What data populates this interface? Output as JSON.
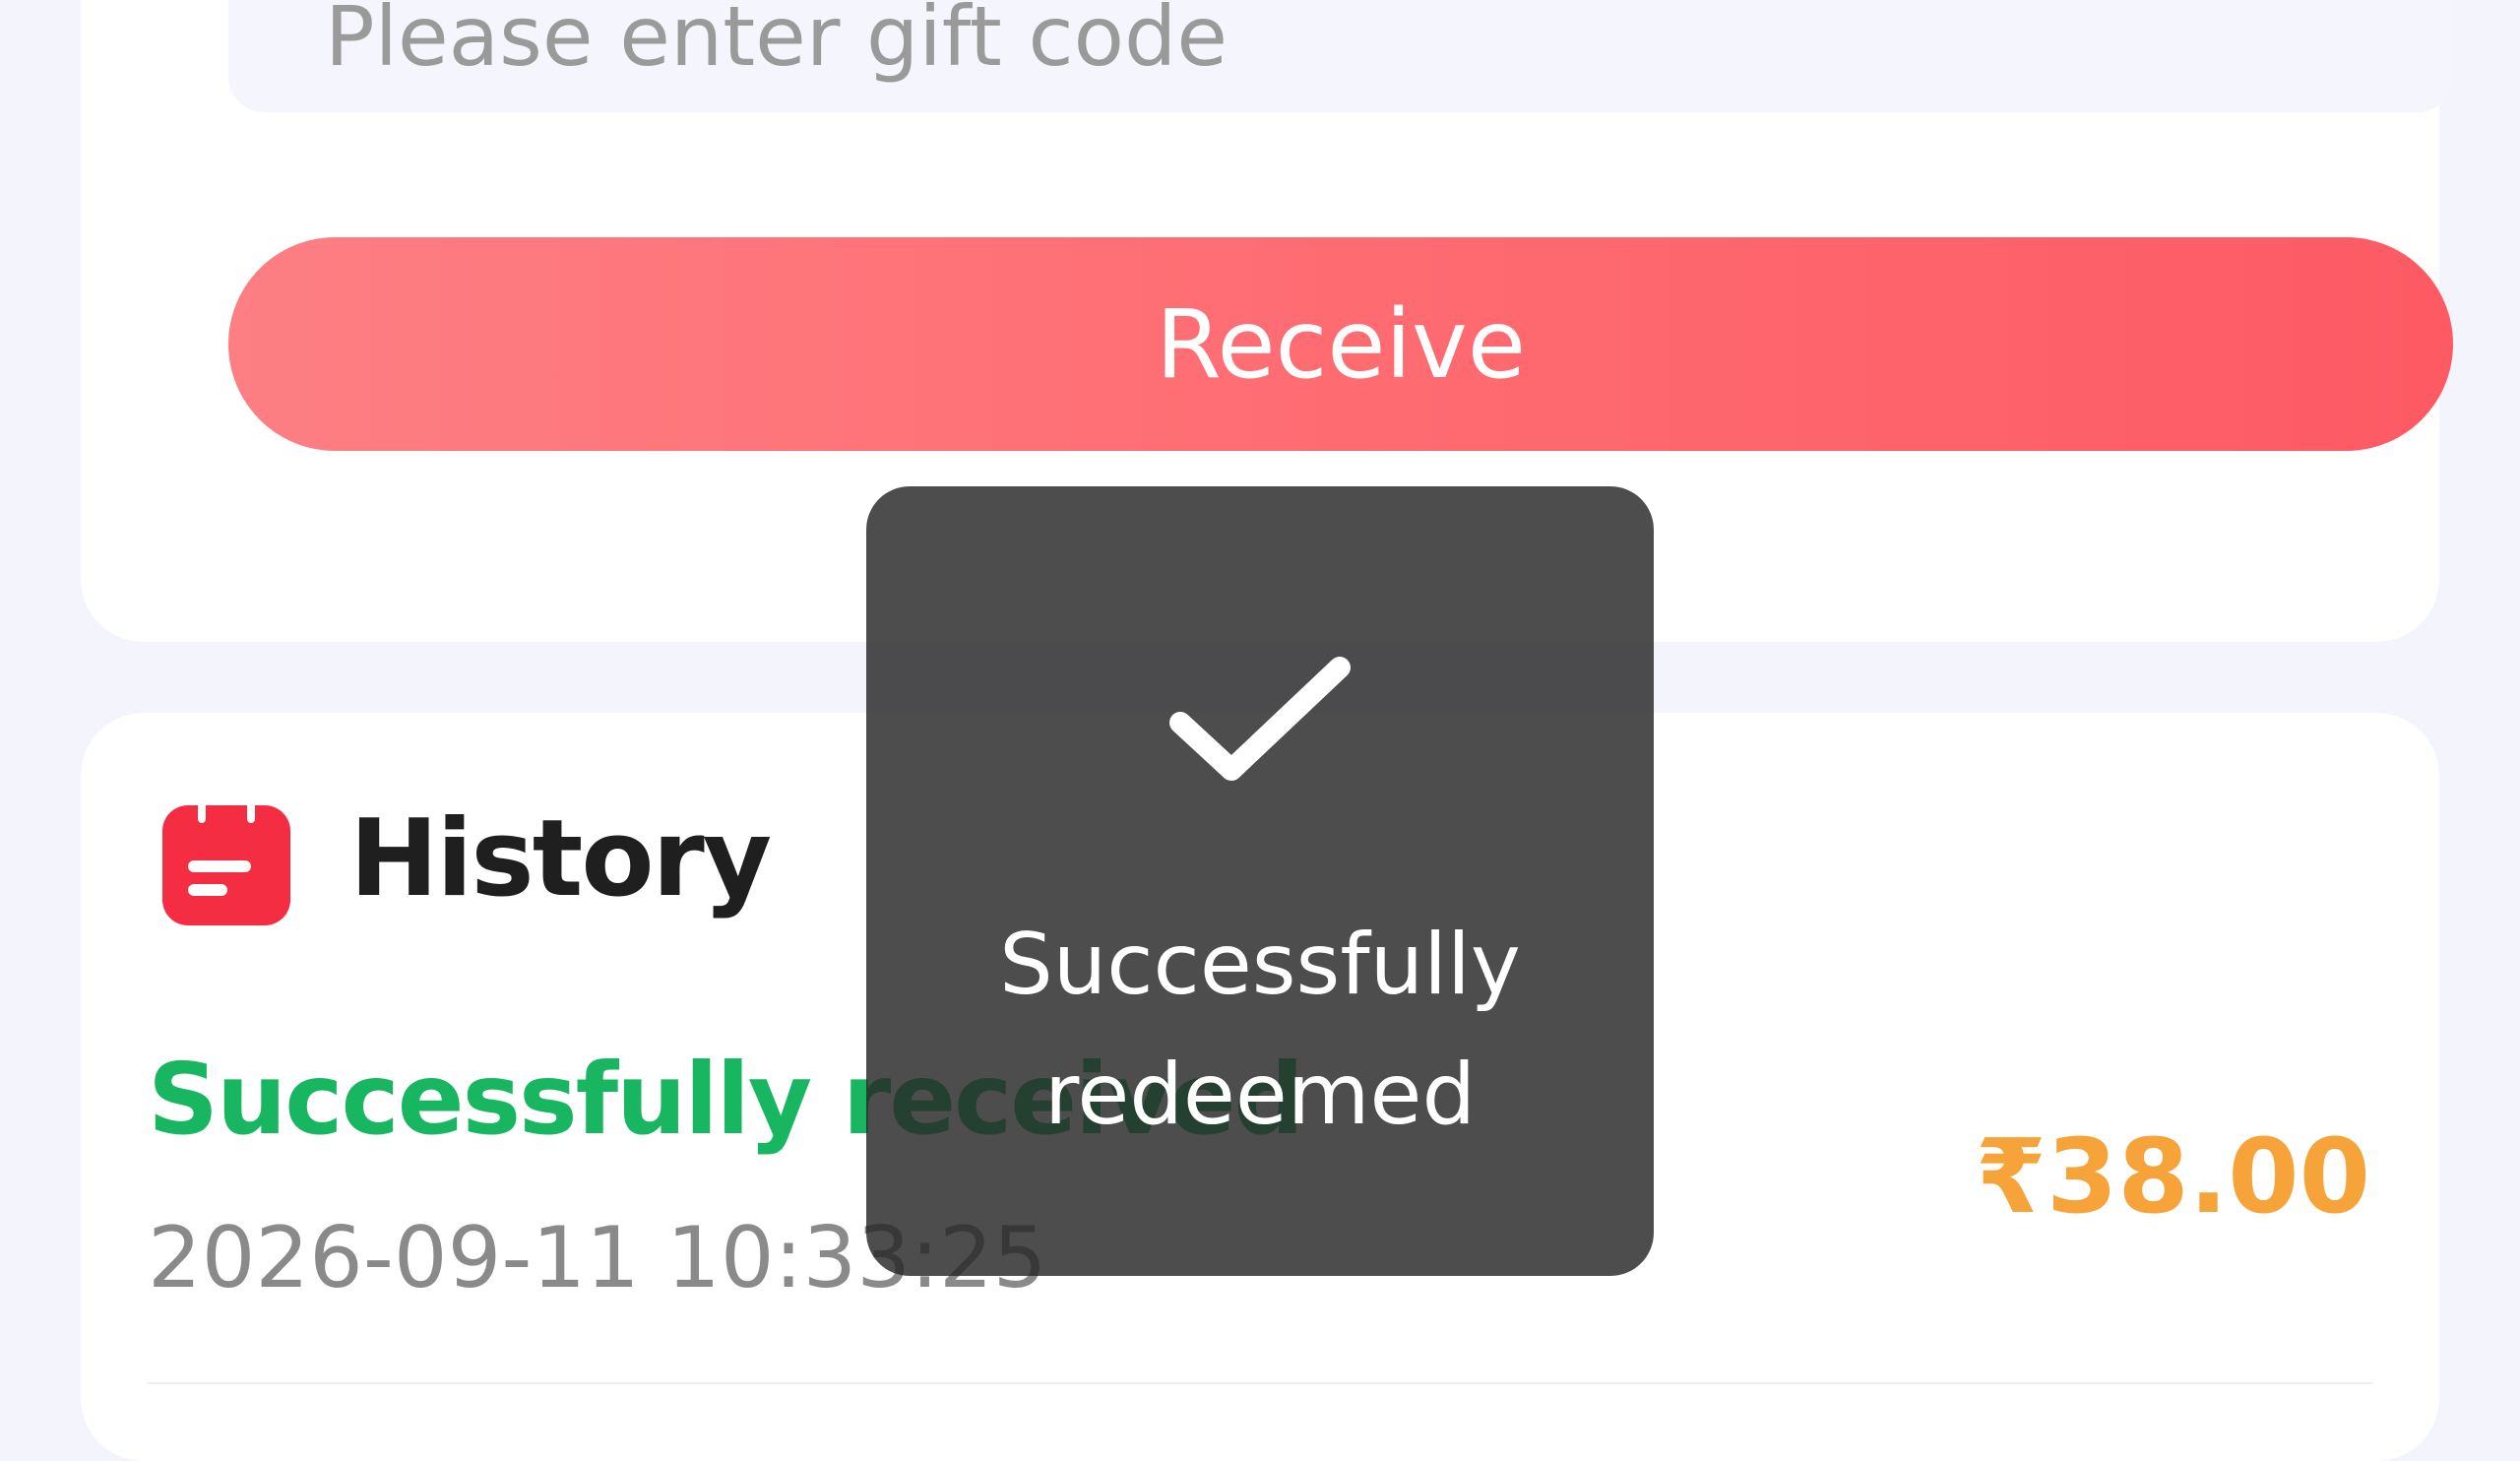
{
  "gift_code": {
    "placeholder": "Please enter gift code",
    "value": "",
    "receive_label": "Receive"
  },
  "history": {
    "title": "History",
    "icon": "calendar-icon",
    "records": [
      {
        "status": "Successfully received",
        "time": "2026-09-11 10:33:25",
        "amount": "₹38.00"
      }
    ]
  },
  "toast": {
    "icon": "checkmark-icon",
    "message": "Successfully redeemed"
  },
  "colors": {
    "accent": "#fd5a64",
    "success": "#18b660",
    "amount": "#f6a43a"
  }
}
